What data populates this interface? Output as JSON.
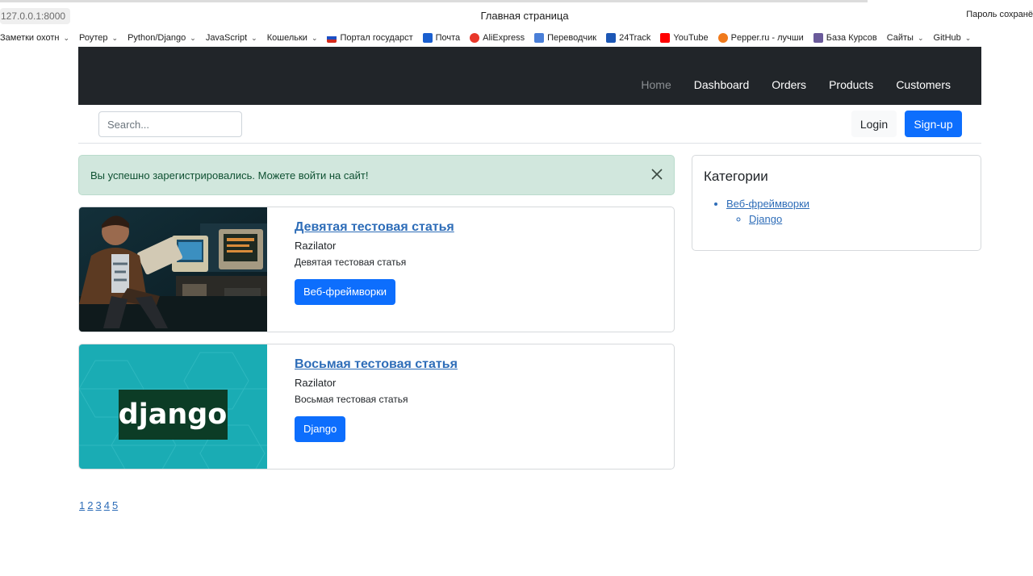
{
  "browser": {
    "url": "127.0.0.1:8000",
    "tab_title": "Главная страница",
    "password_notice": "Пароль сохранё",
    "bookmarks": [
      {
        "label": "Заметки охотн",
        "icon": "folder-icon",
        "dropdown": true
      },
      {
        "label": "Роутер",
        "icon": "folder-icon",
        "dropdown": true
      },
      {
        "label": "Python/Django",
        "icon": "folder-icon",
        "dropdown": true
      },
      {
        "label": "JavaScript",
        "icon": "folder-icon",
        "dropdown": true
      },
      {
        "label": "Кошельки",
        "icon": "folder-icon",
        "dropdown": true
      },
      {
        "label": "Портал государст",
        "icon": "russia-flag-icon",
        "dropdown": false
      },
      {
        "label": "Почта",
        "icon": "mail-icon",
        "dropdown": false
      },
      {
        "label": "AliExpress",
        "icon": "aliexpress-icon",
        "dropdown": false
      },
      {
        "label": "Переводчик",
        "icon": "translate-icon",
        "dropdown": false
      },
      {
        "label": "24Track",
        "icon": "track-icon",
        "dropdown": false
      },
      {
        "label": "YouTube",
        "icon": "youtube-icon",
        "dropdown": false
      },
      {
        "label": "Pepper.ru - лучши",
        "icon": "flame-icon",
        "dropdown": false
      },
      {
        "label": "База Курсов",
        "icon": "feather-icon",
        "dropdown": false
      },
      {
        "label": "Сайты",
        "icon": "folder-icon",
        "dropdown": true
      },
      {
        "label": "GitHub",
        "icon": "folder-icon",
        "dropdown": true
      }
    ]
  },
  "nav": {
    "links": [
      {
        "label": "Home",
        "active": true
      },
      {
        "label": "Dashboard",
        "active": false
      },
      {
        "label": "Orders",
        "active": false
      },
      {
        "label": "Products",
        "active": false
      },
      {
        "label": "Customers",
        "active": false
      }
    ]
  },
  "toolbar": {
    "search_placeholder": "Search...",
    "login_label": "Login",
    "signup_label": "Sign-up"
  },
  "alert": {
    "text": "Вы успешно зарегистрировались. Можете войти на сайт!"
  },
  "articles": [
    {
      "title": "Девятая тестовая статья",
      "author": "Razilator",
      "description": "Девятая тестовая статья",
      "category": "Веб-фреймворки"
    },
    {
      "title": "Восьмая тестовая статья",
      "author": "Razilator",
      "description": "Восьмая тестовая статья",
      "category": "Django",
      "thumb_logo": "django"
    }
  ],
  "pagination": [
    "1",
    "2",
    "3",
    "4",
    "5"
  ],
  "sidebar": {
    "title": "Категории",
    "category": "Веб-фреймворки",
    "subcategory": "Django"
  },
  "colors": {
    "navbar_bg": "#212529",
    "primary": "#0d6efd",
    "alert_bg": "#d1e7dd",
    "alert_text": "#0f5132",
    "link": "#2e6db8",
    "django_bg": "#1aacb4",
    "django_logo_bg": "#0c3c26"
  }
}
